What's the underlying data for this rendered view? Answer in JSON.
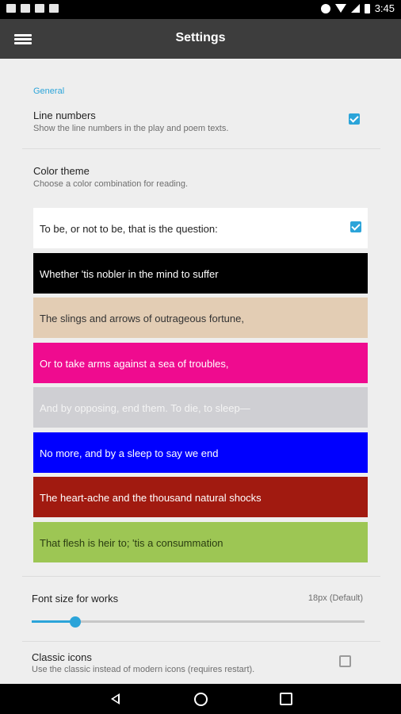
{
  "status_bar": {
    "time": "3:45"
  },
  "app_bar": {
    "title": "Settings",
    "menu_icon": "hamburger-menu-icon"
  },
  "settings": {
    "section_general": "General",
    "line_numbers": {
      "title": "Line numbers",
      "subtitle": "Show the line numbers in the play and poem texts.",
      "checked": true
    },
    "color_theme": {
      "title": "Color theme",
      "subtitle": "Choose a color combination for reading.",
      "options": [
        {
          "text": "To be, or not to be, that is the question:",
          "bg": "#ffffff",
          "fg": "#222222",
          "selected": true
        },
        {
          "text": "Whether 'tis nobler in the mind to suffer",
          "bg": "#000000",
          "fg": "#ffffff",
          "selected": false
        },
        {
          "text": "The slings and arrows of outrageous fortune,",
          "bg": "#e3cdb4",
          "fg": "#333333",
          "selected": false
        },
        {
          "text": "Or to take arms against a sea of troubles,",
          "bg": "#ef0b8f",
          "fg": "#ffffff",
          "selected": false
        },
        {
          "text": "And by opposing, end them. To die, to sleep—",
          "bg": "#cfcfd3",
          "fg": "#f4f4f4",
          "selected": false
        },
        {
          "text": "No more, and by a sleep to say we end",
          "bg": "#0000ff",
          "fg": "#ffffff",
          "selected": false
        },
        {
          "text": "The heart-ache and the thousand natural shocks",
          "bg": "#a11a10",
          "fg": "#ffffff",
          "selected": false
        },
        {
          "text": "That flesh is heir to; 'tis a consummation",
          "bg": "#9dc654",
          "fg": "#2b3d12",
          "selected": false
        }
      ]
    },
    "font_size": {
      "title": "Font size for works",
      "value_label": "18px (Default)",
      "slider_fraction": 0.13
    },
    "classic_icons": {
      "title": "Classic icons",
      "subtitle": "Use the classic instead of modern icons (requires restart).",
      "checked": false
    }
  },
  "colors": {
    "accent": "#2ba4d9",
    "app_bar": "#3d3d3d",
    "background": "#eeeeee"
  }
}
